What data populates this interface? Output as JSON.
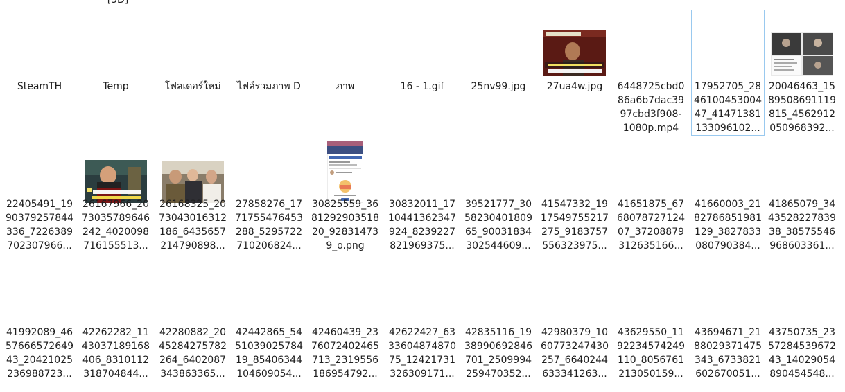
{
  "partial_label_top": "[3D]",
  "rows": [
    {
      "items": [
        {
          "label": "SteamTH",
          "thumb": "none"
        },
        {
          "label": "Temp",
          "thumb": "none"
        },
        {
          "label": "โฟลเดอร์ใหม่",
          "thumb": "none"
        },
        {
          "label": "ไฟล์รวมภาพ D",
          "thumb": "none"
        },
        {
          "label": "ภาพ",
          "thumb": "none"
        },
        {
          "label": "16 - 1.gif",
          "thumb": "none"
        },
        {
          "label": "25nv99.jpg",
          "thumb": "none"
        },
        {
          "label": "27ua4w.jpg",
          "thumb": "photo-meme-man"
        },
        {
          "label": "6448725cbd0\n86a6b7dac39\n97cbd3f908-\n1080p.mp4",
          "thumb": "none"
        },
        {
          "label": "17952705_28\n46100453004\n47_41471381\n133096102...",
          "thumb": "none",
          "selected": true
        },
        {
          "label": "20046463_15\n89508691119\n815_4562912\n050968392...",
          "thumb": "screenshot-collage"
        }
      ]
    },
    {
      "items": [
        {
          "label": "22405491_19\n90379257844\n336_7226389\n702307966...",
          "thumb": "none"
        },
        {
          "label": "26167966_20\n73035789646\n242_4020098\n716155513...",
          "thumb": "photo-captain"
        },
        {
          "label": "26168325_20\n73043016312\n186_6435657\n214790898...",
          "thumb": "photo-group"
        },
        {
          "label": "27858276_17\n71755476453\n288_5295722\n710206824...",
          "thumb": "none"
        },
        {
          "label": "30825559_36\n81292903518\n20_92831473\n9_o.png",
          "thumb": "phone-screenshot"
        },
        {
          "label": "30832011_17\n10441362347\n924_8239227\n821969375...",
          "thumb": "none"
        },
        {
          "label": "39521777_30\n58230401809\n65_90031834\n302544609...",
          "thumb": "none"
        },
        {
          "label": "41547332_19\n17549755217\n275_9183757\n556323975...",
          "thumb": "none"
        },
        {
          "label": "41651875_67\n68078727124\n07_37208879\n312635166...",
          "thumb": "none"
        },
        {
          "label": "41660003_21\n82786851981\n129_3827833\n080790384...",
          "thumb": "none"
        },
        {
          "label": "41865079_34\n43528227839\n38_38575546\n968603361...",
          "thumb": "none"
        }
      ]
    },
    {
      "items": [
        {
          "label": "41992089_46\n57666572649\n43_20421025\n236988723...",
          "thumb": "none"
        },
        {
          "label": "42262282_11\n43037189168\n406_8310112\n318704844...",
          "thumb": "none"
        },
        {
          "label": "42280882_20\n45284275782\n264_6402087\n343863365...",
          "thumb": "none"
        },
        {
          "label": "42442865_54\n51039025784\n19_85406344\n104609054...",
          "thumb": "none"
        },
        {
          "label": "42460439_23\n76072402465\n713_2319556\n186954792...",
          "thumb": "none"
        },
        {
          "label": "42622427_63\n33604874870\n75_12421731\n326309171...",
          "thumb": "none"
        },
        {
          "label": "42835116_19\n38990692846\n701_2509994\n259470352...",
          "thumb": "none"
        },
        {
          "label": "42980379_10\n60773247430\n257_6640244\n633341263...",
          "thumb": "none"
        },
        {
          "label": "43629550_11\n92234574249\n110_8056761\n213050159...",
          "thumb": "none"
        },
        {
          "label": "43694671_21\n88029371475\n343_6733821\n602670051...",
          "thumb": "none"
        },
        {
          "label": "43750735_23\n57284539672\n43_14029054\n890454548...",
          "thumb": "none"
        }
      ]
    }
  ],
  "colors": {
    "selection_border": "#99c9ef",
    "text": "#1f1f1f"
  }
}
